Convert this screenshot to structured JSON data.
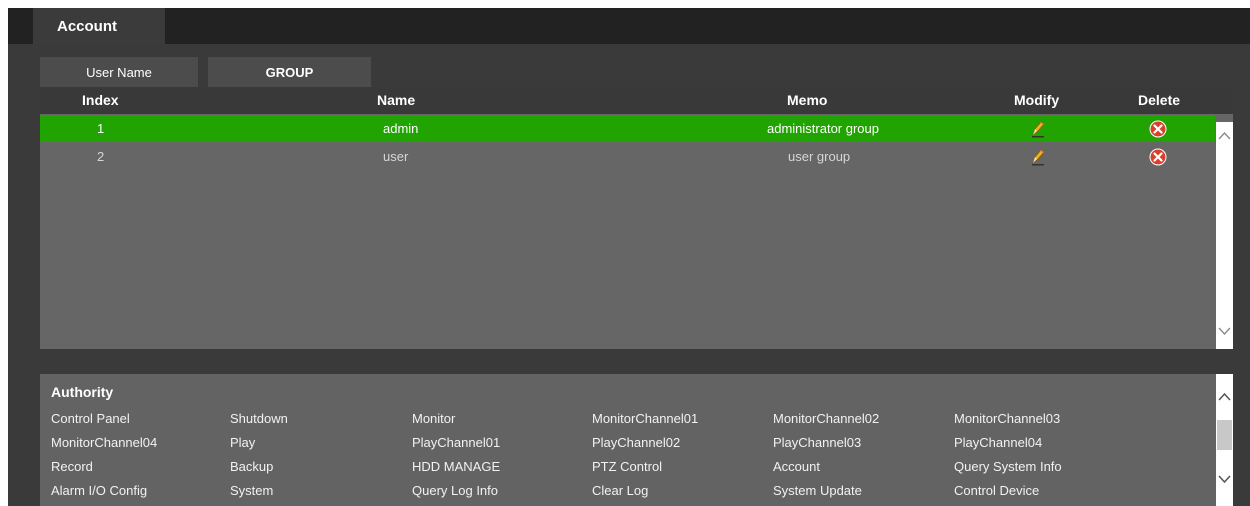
{
  "header": {
    "tab_label": "Account"
  },
  "subtabs": [
    "User Name",
    "GROUP"
  ],
  "table": {
    "columns": [
      "Index",
      "Name",
      "Memo",
      "Modify",
      "Delete"
    ],
    "rows": [
      {
        "index": "1",
        "name": "admin",
        "memo": "administrator group",
        "selected": true
      },
      {
        "index": "2",
        "name": "user",
        "memo": "user group",
        "selected": false
      }
    ]
  },
  "authority": {
    "title": "Authority",
    "items": [
      [
        "Control Panel",
        "Shutdown",
        "Monitor",
        "MonitorChannel01",
        "MonitorChannel02",
        "MonitorChannel03"
      ],
      [
        "MonitorChannel04",
        "Play",
        "PlayChannel01",
        "PlayChannel02",
        "PlayChannel03",
        "PlayChannel04"
      ],
      [
        "Record",
        "Backup",
        "HDD MANAGE",
        "PTZ Control",
        "Account",
        "Query System Info"
      ],
      [
        "Alarm I/O Config",
        "System",
        "Query Log Info",
        "Clear Log",
        "System Update",
        "Control Device"
      ]
    ]
  },
  "colors": {
    "selected_row": "#21a302",
    "background": "#3a3a3a",
    "table_body": "#666666",
    "header_bar": "#222222"
  },
  "icons": {
    "modify": "pencil-icon",
    "delete": "delete-x-icon"
  }
}
